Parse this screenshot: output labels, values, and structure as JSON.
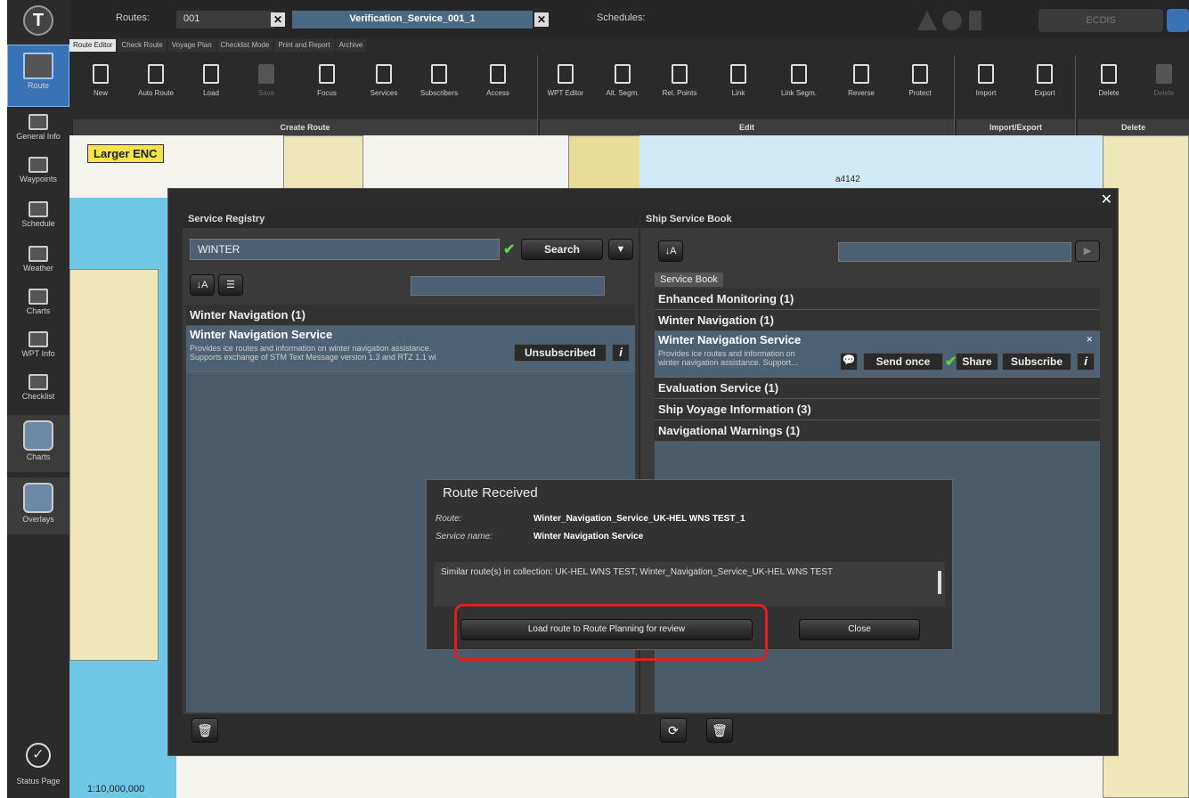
{
  "app": {
    "logo": "T"
  },
  "left_nav": {
    "route": "Route",
    "items": [
      "General Info",
      "Waypoints",
      "Schedule",
      "Weather",
      "Charts",
      "WPT Info",
      "Checklist"
    ],
    "charts": "Charts",
    "overlays": "Overlays",
    "status": "Status Page"
  },
  "topbar": {
    "routes_label": "Routes:",
    "route_number": "001",
    "route_name": "Verification_Service_001_1",
    "schedules_label": "Schedules:",
    "ecdis_label": "ECDIS"
  },
  "ribbon": {
    "tabs": [
      "Route Editor",
      "Check Route",
      "Voyage Plan",
      "Checklist Mode",
      "Print and Report",
      "Archive"
    ],
    "create_route": {
      "label": "Create Route",
      "buttons": [
        "New",
        "Auto Route",
        "Load",
        "Save",
        "Focus",
        "Services",
        "Subscribers",
        "Access"
      ]
    },
    "edit": {
      "label": "Edit",
      "buttons": [
        "WPT Editor",
        "Alt. Segm.",
        "Rel. Points",
        "Link",
        "Link Segm.",
        "Reverse",
        "Protect"
      ]
    },
    "import_export": {
      "label": "Import/Export",
      "buttons": [
        "Import",
        "Export"
      ]
    },
    "delete": {
      "label": "Delete",
      "buttons": [
        "Delete",
        "Delete"
      ]
    }
  },
  "chart": {
    "enc_label": "Larger ENC",
    "scale": "1:10,000,000",
    "depth_label": "a4142"
  },
  "service_registry": {
    "title": "Service Registry",
    "search_value": "WINTER",
    "search_button": "Search",
    "group": "Winter Navigation (1)",
    "item": {
      "title": "Winter Navigation Service",
      "desc_line1": "Provides ice routes and information on winter navigation assistance.",
      "desc_line2": "Supports exchange of STM Text Message version 1.3 and RTZ 1.1 wi",
      "status_button": "Unsubscribed",
      "info": "i"
    }
  },
  "ship_service_book": {
    "title": "Ship Service Book",
    "tab": "Service Book",
    "groups": [
      "Enhanced Monitoring (1)",
      "Winter Navigation (1)",
      "Evaluation Service (1)",
      "Ship Voyage Information (3)",
      "Navigational Warnings (1)"
    ],
    "item": {
      "title": "Winter Navigation Service",
      "desc_line1": "Provides ice routes and information on",
      "desc_line2": "winter navigation assistance. Support...",
      "send_once": "Send once",
      "share": "Share",
      "subscribe": "Subscribe",
      "info": "i"
    }
  },
  "route_received": {
    "title": "Route Received",
    "route_label": "Route:",
    "route_value": "Winter_Navigation_Service_UK-HEL WNS TEST_1",
    "service_label": "Service name:",
    "service_value": "Winter Navigation Service",
    "similar": "Similar route(s) in collection: UK-HEL WNS TEST, Winter_Navigation_Service_UK-HEL WNS TEST",
    "load_button": "Load route to Route Planning for review",
    "close_button": "Close"
  }
}
